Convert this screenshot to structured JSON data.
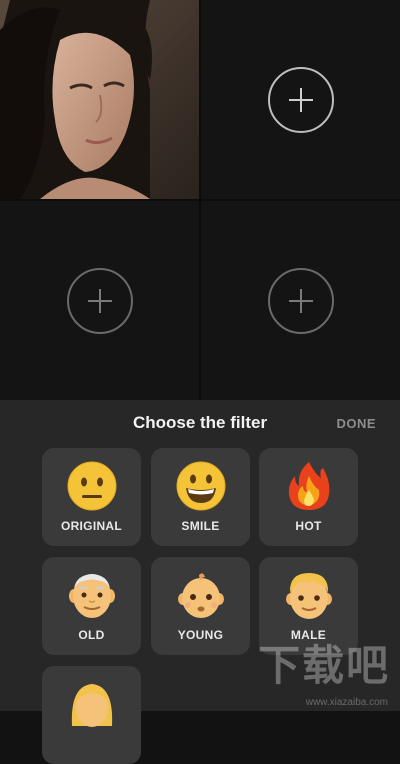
{
  "colors": {
    "background": "#121212",
    "sheet": "#272727",
    "tile": "#3a3a3a",
    "plus_ring": "#6a6a6a",
    "emoji_yellow": "#f5c338",
    "flame_red": "#e8411c"
  },
  "grid": {
    "slots": [
      {
        "state": "photo",
        "icon": "portrait-photo"
      },
      {
        "state": "empty",
        "icon": "plus-icon"
      },
      {
        "state": "empty",
        "icon": "plus-icon"
      },
      {
        "state": "empty",
        "icon": "plus-icon"
      }
    ]
  },
  "filter_sheet": {
    "title": "Choose the filter",
    "done_label": "DONE",
    "filters": [
      {
        "label": "ORIGINAL",
        "icon": "neutral-face-emoji"
      },
      {
        "label": "SMILE",
        "icon": "grinning-face-emoji"
      },
      {
        "label": "HOT",
        "icon": "fire-emoji"
      },
      {
        "label": "OLD",
        "icon": "old-man-emoji"
      },
      {
        "label": "YOUNG",
        "icon": "baby-emoji"
      },
      {
        "label": "MALE",
        "icon": "boy-emoji"
      },
      {
        "label": "",
        "icon": "woman-emoji"
      }
    ]
  },
  "watermark": {
    "text": "下载吧",
    "url": "www.xiazaiba.com"
  }
}
